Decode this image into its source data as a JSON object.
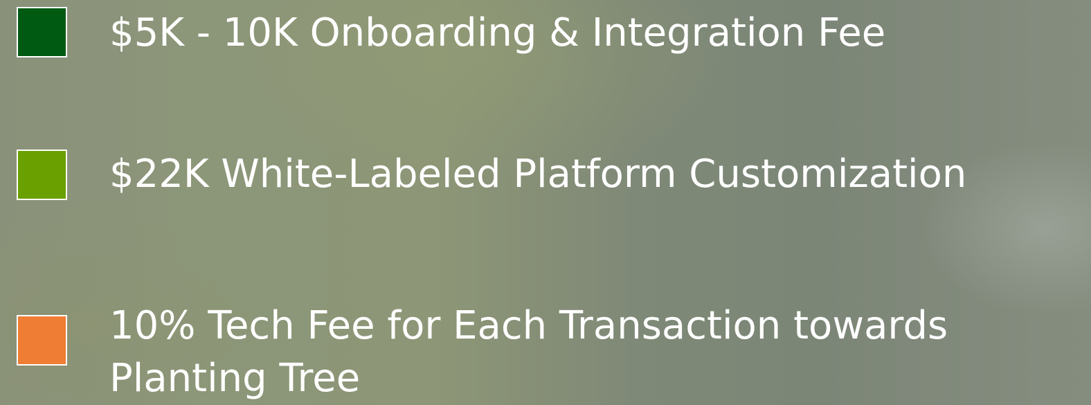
{
  "legend": {
    "items": [
      {
        "label": "$5K - 10K Onboarding & Integration Fee",
        "color": "#005a12"
      },
      {
        "label": "$22K White-Labeled Platform Customization",
        "color": "#6aa000"
      },
      {
        "label": "10% Tech Fee for Each Transaction towards Planting Tree",
        "color": "#ef7d33"
      }
    ]
  }
}
